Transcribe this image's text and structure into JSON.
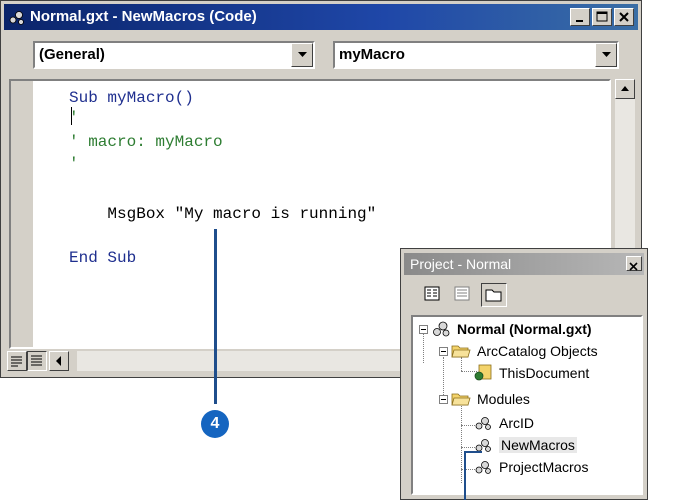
{
  "code_window": {
    "title": "Normal.gxt - NewMacros (Code)",
    "object_combo": "(General)",
    "procedure_combo": "myMacro",
    "code": {
      "line1": "Sub myMacro()",
      "line2": "'",
      "line3": "' macro: myMacro",
      "line4": "'",
      "line5": "    MsgBox \"My macro is running\"",
      "line6": "End Sub"
    },
    "colors": {
      "keyword": "#1f2f8f",
      "comment": "#2e7d32",
      "title_bar": "#0a246a"
    }
  },
  "callout": {
    "number": "4",
    "color": "#1565c0"
  },
  "project_window": {
    "title": "Project - Normal",
    "tree": {
      "root": "Normal (Normal.gxt)",
      "arccatalog_objects": "ArcCatalog Objects",
      "this_document": "ThisDocument",
      "modules": "Modules",
      "arcid": "ArcID",
      "newmacros": "NewMacros",
      "projectmacros": "ProjectMacros"
    }
  }
}
